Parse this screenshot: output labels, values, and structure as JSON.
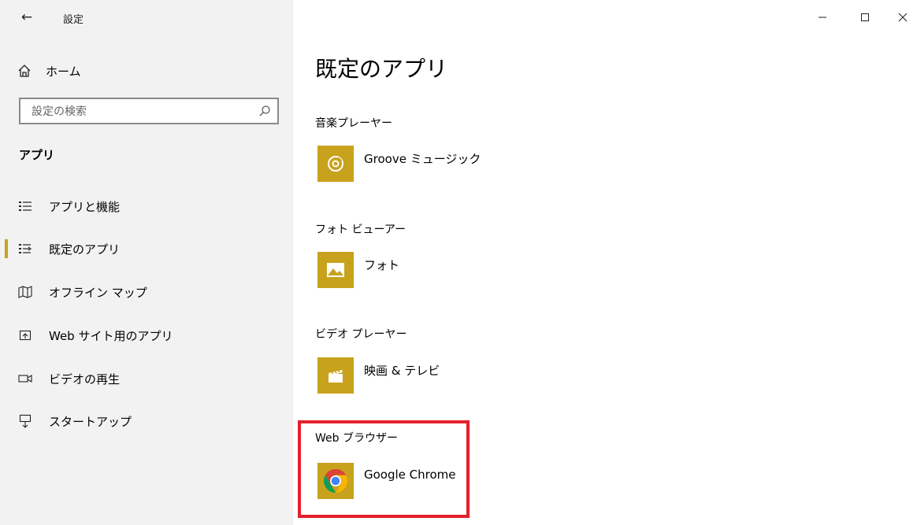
{
  "window": {
    "title": "設定",
    "controls": {
      "minimize": "minimize-icon",
      "maximize": "maximize-icon",
      "close": "close-icon"
    }
  },
  "sidebar": {
    "home_label": "ホーム",
    "search": {
      "placeholder": "設定の検索"
    },
    "section_heading": "アプリ",
    "items": [
      {
        "label": "アプリと機能",
        "icon": "apps-features-icon",
        "selected": false
      },
      {
        "label": "既定のアプリ",
        "icon": "default-apps-icon",
        "selected": true
      },
      {
        "label": "オフライン マップ",
        "icon": "offline-maps-icon",
        "selected": false
      },
      {
        "label": "Web サイト用のアプリ",
        "icon": "apps-for-websites-icon",
        "selected": false
      },
      {
        "label": "ビデオの再生",
        "icon": "video-playback-icon",
        "selected": false
      },
      {
        "label": "スタートアップ",
        "icon": "startup-icon",
        "selected": false
      }
    ]
  },
  "main": {
    "title": "既定のアプリ",
    "categories": [
      {
        "label": "音楽プレーヤー",
        "app_name": "Groove ミュージック",
        "icon": "groove-music-icon"
      },
      {
        "label": "フォト ビューアー",
        "app_name": "フォト",
        "icon": "photos-icon"
      },
      {
        "label": "ビデオ プレーヤー",
        "app_name": "映画 & テレビ",
        "icon": "movies-tv-icon"
      },
      {
        "label": "Web ブラウザー",
        "app_name": "Google Chrome",
        "icon": "chrome-icon"
      }
    ]
  },
  "colors": {
    "accent": "#c8a21c",
    "highlight": "#e5202d",
    "sidebar_bg": "#f2f2f2"
  }
}
